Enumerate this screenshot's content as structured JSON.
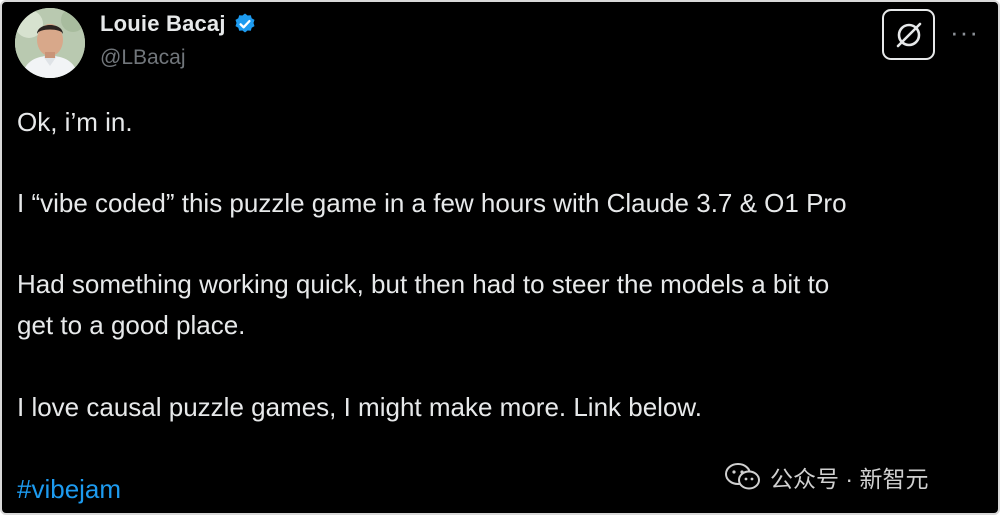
{
  "author": {
    "display_name": "Louie Bacaj",
    "handle": "@LBacaj",
    "verified": true,
    "verified_color": "#1d9bf0"
  },
  "header_actions": {
    "grok_icon": "grok-icon",
    "more_icon": "more-icon",
    "more_label": "···"
  },
  "tweet": {
    "paragraphs": [
      "Ok, i’m in.",
      "I “vibe coded” this puzzle game in a few hours with Claude 3.7 & O1 Pro",
      "Had something working quick, but then had to steer the models a bit to",
      "get to a good place.",
      "I love causal puzzle games, I might make more. Link below."
    ],
    "hashtag": "#vibejam"
  },
  "watermark": {
    "text": "公众号 · 新智元",
    "icon": "wechat-icon"
  },
  "colors": {
    "background": "#000000",
    "text": "#e7e9ea",
    "muted": "#71767b",
    "link": "#1d9bf0"
  }
}
